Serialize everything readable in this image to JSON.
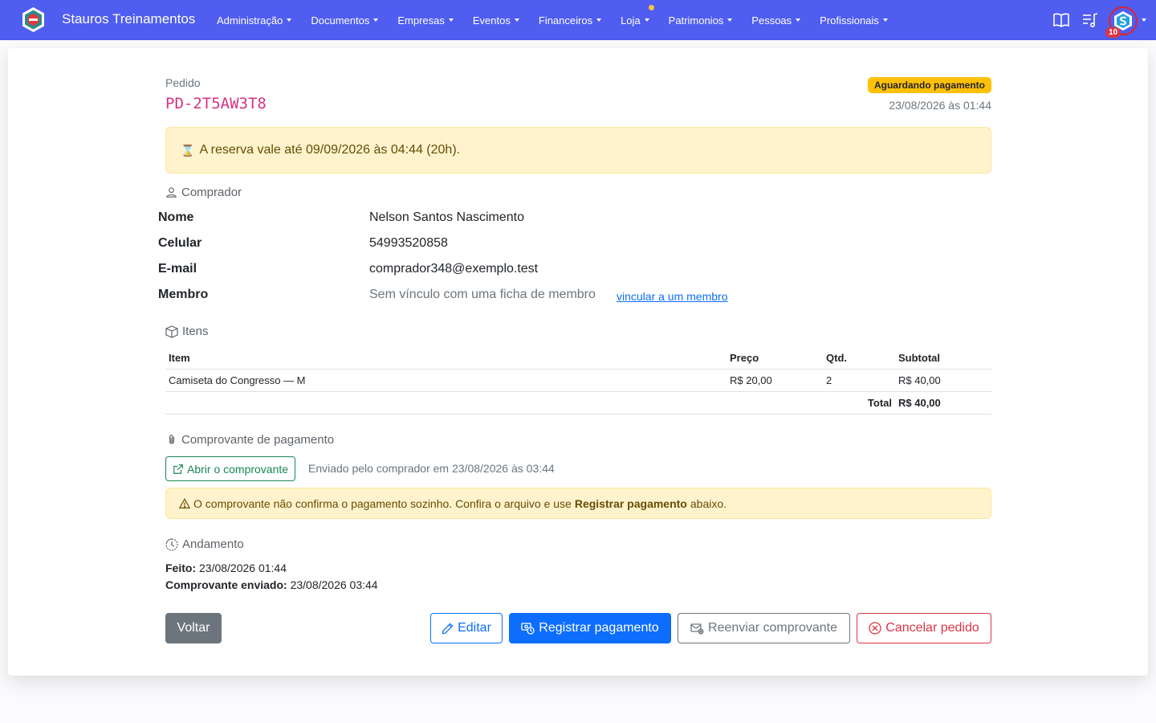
{
  "navbar": {
    "brand": "Stauros Treinamentos",
    "menu": [
      {
        "label": "Administração"
      },
      {
        "label": "Documentos"
      },
      {
        "label": "Empresas"
      },
      {
        "label": "Eventos"
      },
      {
        "label": "Financeiros"
      },
      {
        "label": "Loja",
        "has_dot": true
      },
      {
        "label": "Patrimonios"
      },
      {
        "label": "Pessoas"
      },
      {
        "label": "Profissionais"
      }
    ],
    "icons": [
      "book-icon",
      "music-list-icon"
    ],
    "avatar_badge": "10",
    "colors": {
      "background": "#4f5df0",
      "dot": "#f5c542",
      "badge": "#dc3545"
    }
  },
  "order": {
    "label": "Pedido",
    "code": "PD-2T5AW3T8",
    "status": "Aguardando pagamento",
    "date": "23/08/2026 às 01:44",
    "reservation_notice": "A reserva vale até 09/09/2026 às 04:44 (20h)."
  },
  "buyer": {
    "section_title": "Comprador",
    "name_label": "Nome",
    "name": "Nelson Santos Nascimento",
    "phone_label": "Celular",
    "phone": "54993520858",
    "email_label": "E-mail",
    "email": "comprador348@exemplo.test",
    "member_label": "Membro",
    "member_value": "Sem vínculo com uma ficha de membro",
    "member_link": "vincular a um membro"
  },
  "items": {
    "section_title": "Itens",
    "headers": {
      "item": "Item",
      "price": "Preço",
      "qty": "Qtd.",
      "subtotal": "Subtotal"
    },
    "rows": [
      {
        "item": "Camiseta do Congresso — M",
        "price": "R$ 20,00",
        "qty": "2",
        "subtotal": "R$ 40,00"
      }
    ],
    "total_label": "Total",
    "total_value": "R$ 40,00"
  },
  "receipt": {
    "section_title": "Comprovante de pagamento",
    "open_button": "Abrir o comprovante",
    "sent_by": "Enviado pelo comprador em 23/08/2026 às 03:44",
    "warning_prefix": "O comprovante não confirma o pagamento sozinho. Confira o arquivo e use",
    "warning_bold": "Registrar pagamento",
    "warning_suffix": "abaixo."
  },
  "progress": {
    "section_title": "Andamento",
    "made_label": "Feito:",
    "made_value": "23/08/2026 01:44",
    "sent_label": "Comprovante enviado:",
    "sent_value": "23/08/2026 03:44"
  },
  "actions": {
    "back": "Voltar",
    "edit": "Editar",
    "register_payment": "Registrar pagamento",
    "resend_receipt": "Reenviar comprovante",
    "cancel_order": "Cancelar pedido"
  }
}
